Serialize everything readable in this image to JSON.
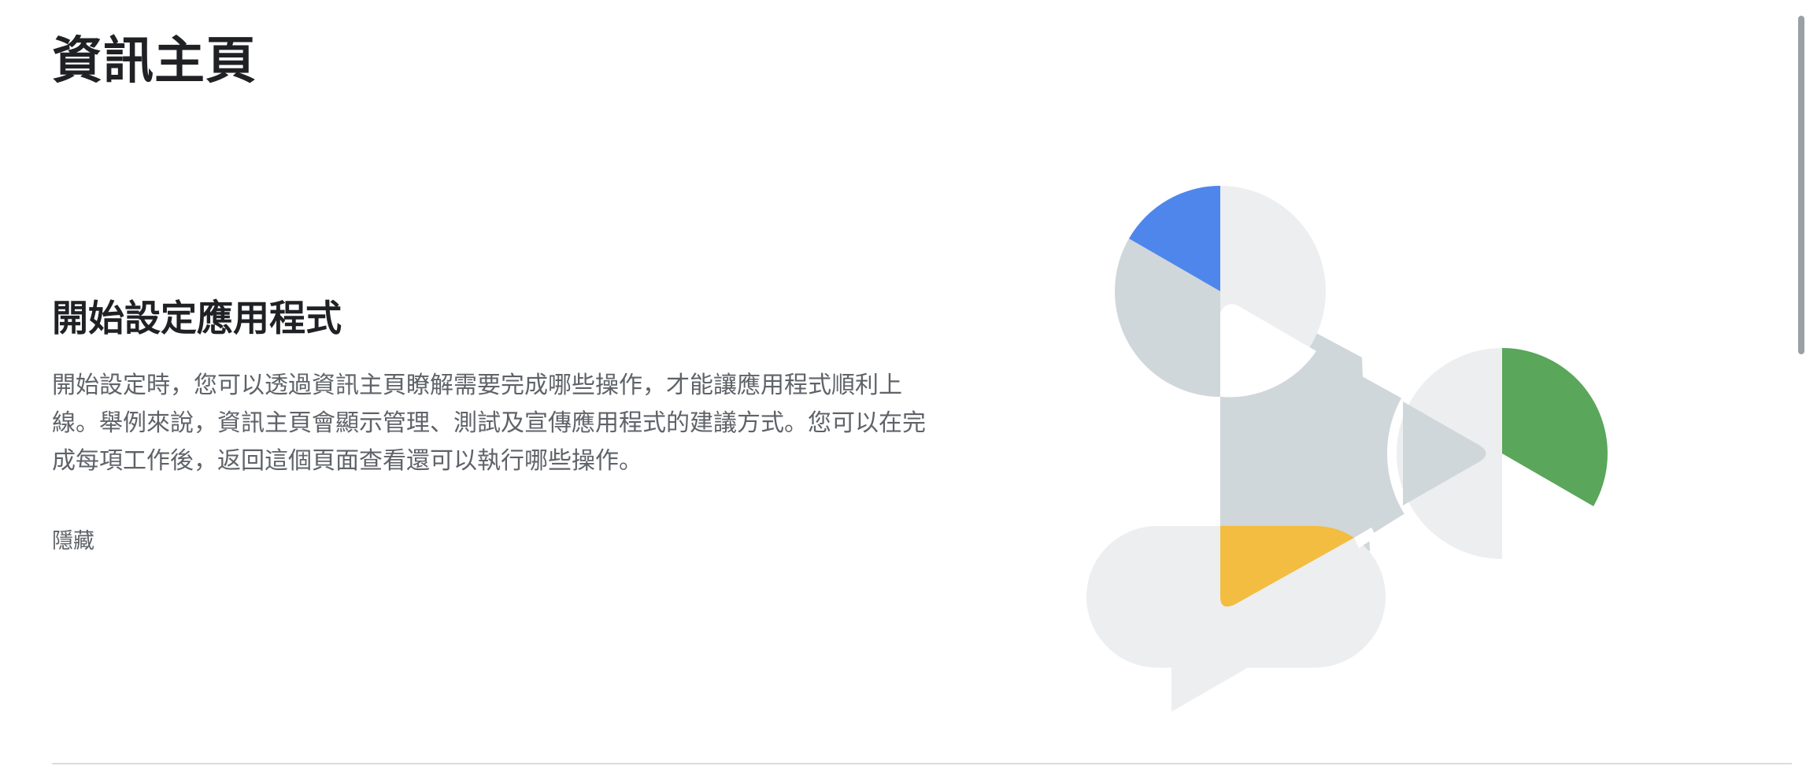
{
  "page": {
    "title": "資訊主頁"
  },
  "setup_card": {
    "heading": "開始設定應用程式",
    "body": "開始設定時，您可以透過資訊主頁瞭解需要完成哪些操作，才能讓應用程式順利上線。舉例來說，資訊主頁會顯示管理、測試及宣傳應用程式的建議方式。您可以在完成每項工作後，返回這個頁面查看還可以執行哪些操作。",
    "hide_label": "隱藏"
  },
  "illustration": {
    "icon": "app-setup-illustration",
    "colors": {
      "blue": "#4f86ec",
      "green": "#5aa65a",
      "yellow": "#f2bd41",
      "light_gray": "#eceef0",
      "mid_gray": "#d0d7da"
    }
  }
}
